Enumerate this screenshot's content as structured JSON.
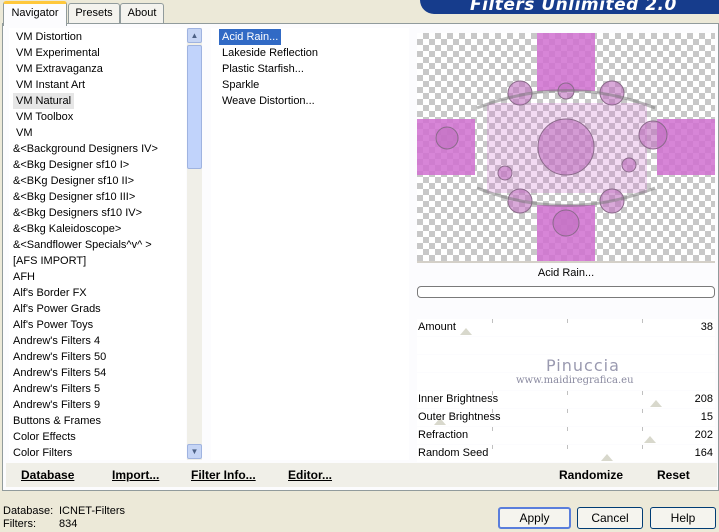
{
  "tabs": [
    {
      "label": "Navigator"
    },
    {
      "label": "Presets"
    },
    {
      "label": "About"
    }
  ],
  "banner_title": "Filters Unlimited 2.0",
  "categories": [
    "VM Distortion",
    "VM Experimental",
    "VM Extravaganza",
    "VM Instant Art",
    "VM Natural",
    "VM Toolbox",
    "VM",
    "&<Background Designers IV>",
    "&<Bkg Designer sf10 I>",
    "&<BKg Designer sf10 II>",
    "&<Bkg Designer sf10 III>",
    "&<Bkg Designers sf10 IV>",
    "&<Bkg Kaleidoscope>",
    "&<Sandflower Specials^v^ >",
    "[AFS IMPORT]",
    "AFH",
    "Alf's Border FX",
    "Alf's Power Grads",
    "Alf's Power Toys",
    "Andrew's Filters 4",
    "Andrew's Filters 50",
    "Andrew's Filters 54",
    "Andrew's Filters 5",
    "Andrew's Filters 9",
    "Buttons & Frames",
    "Color Effects",
    "Color Filters"
  ],
  "selected_category": "VM Natural",
  "filters": [
    "Acid Rain...",
    "Lakeside Reflection",
    "Plastic Starfish...",
    "Sparkle",
    "Weave Distortion..."
  ],
  "selected_filter": "Acid Rain...",
  "preview_filter_label": "Acid Rain...",
  "sliders": [
    {
      "label": "Amount",
      "value": 38
    },
    {
      "label": "Inner Brightness",
      "value": 208
    },
    {
      "label": "Outer Brightness",
      "value": 15
    },
    {
      "label": "Refraction",
      "value": 202
    },
    {
      "label": "Random Seed",
      "value": 164
    }
  ],
  "watermark": {
    "name": "Pinuccia",
    "url": "www.maidiregrafica.eu"
  },
  "bottom_buttons": {
    "database": "Database",
    "import": "Import...",
    "filter_info": "Filter Info...",
    "editor": "Editor...",
    "randomize": "Randomize",
    "reset": "Reset"
  },
  "status": {
    "database_label": "Database:",
    "database_value": "ICNET-Filters",
    "filters_label": "Filters:",
    "filters_value": "834"
  },
  "dialog_buttons": {
    "apply": "Apply",
    "cancel": "Cancel",
    "help": "Help"
  },
  "colors": {
    "selection_blue": "#316ac5",
    "banner_blue": "#163c8c",
    "preview_pink": "#d070d0"
  }
}
